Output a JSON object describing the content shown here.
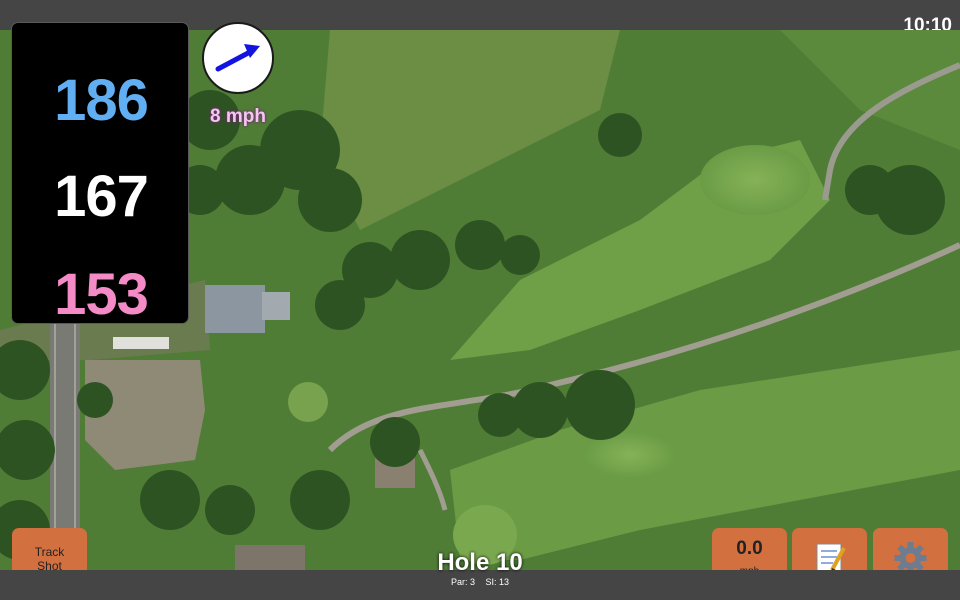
{
  "status_bar": {
    "time": "10:10"
  },
  "distances": {
    "back": "186",
    "middle": "167",
    "front": "153"
  },
  "wind": {
    "speed_label": "8 mph",
    "direction": "east-northeast"
  },
  "hole": {
    "title": "Hole 10",
    "par": "Par: 3",
    "stroke_index": "SI: 13"
  },
  "buttons": {
    "track_shot_line1": "Track",
    "track_shot_line2": "Shot",
    "speed_value": "0.0",
    "speed_unit": "mph",
    "scorecard_icon": "memo-icon",
    "settings_icon": "gear-icon"
  },
  "colors": {
    "accent_button": "#d2703f",
    "back_distance": "#62aef3",
    "middle_distance": "#ffffff",
    "front_distance": "#f48bc7",
    "wind_label": "#f2c9ee"
  }
}
